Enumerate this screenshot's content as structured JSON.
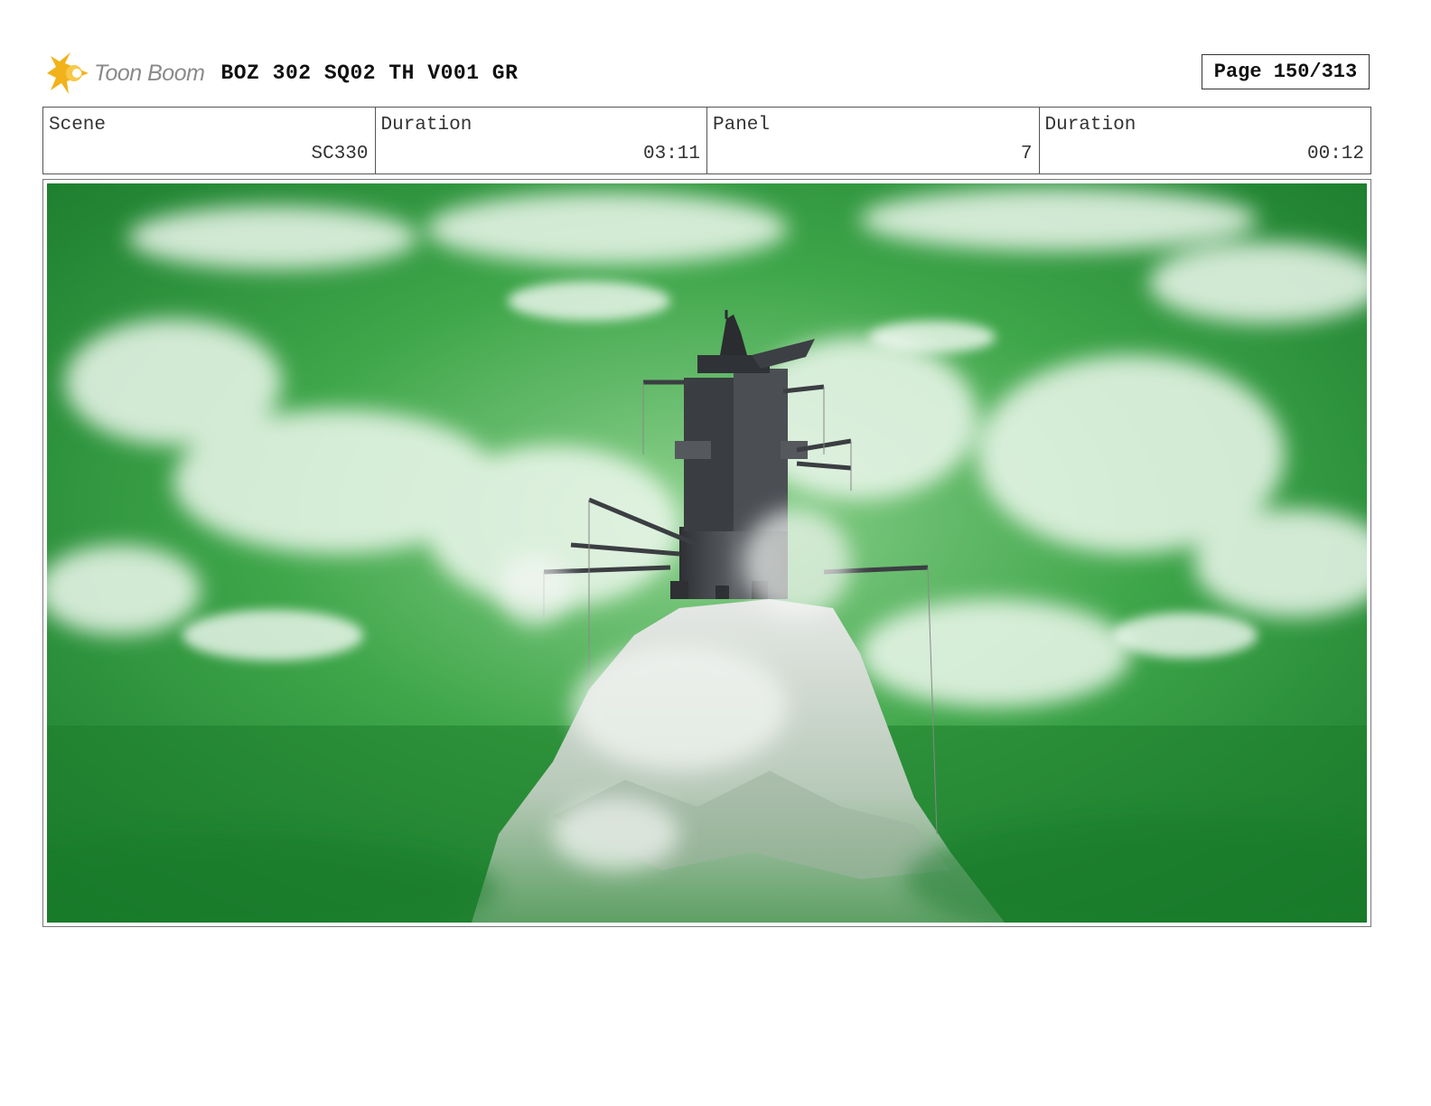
{
  "header": {
    "logo_text": "Toon Boom",
    "title": "BOZ 302 SQ02 TH V001 GR",
    "page": "Page 150/313"
  },
  "info": [
    {
      "label": "Scene",
      "value": "SC330"
    },
    {
      "label": "Duration",
      "value": "03:11"
    },
    {
      "label": "Panel",
      "value": "7"
    },
    {
      "label": "Duration",
      "value": "00:12"
    }
  ],
  "colors": {
    "sky_green": "#1f8f2e",
    "cloud": "#e8f4e8",
    "tower": "#4a4d52",
    "rock": "#d9dcd9",
    "logo_yellow": "#f2b21b"
  }
}
